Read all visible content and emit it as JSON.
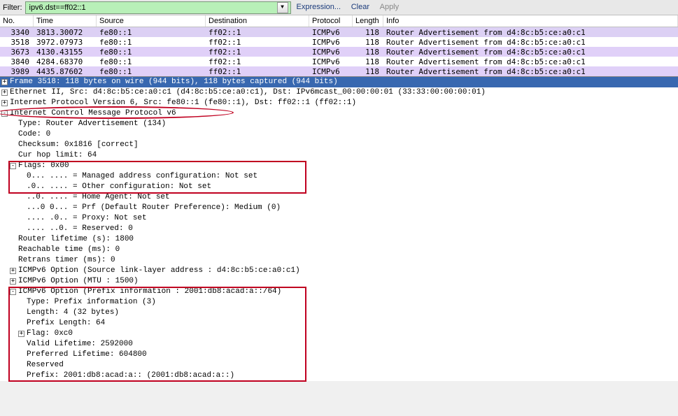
{
  "filter": {
    "label": "Filter:",
    "value": "ipv6.dst==ff02::1",
    "links": {
      "expr": "Expression...",
      "clear": "Clear",
      "apply": "Apply"
    }
  },
  "columns": {
    "no": "No.",
    "time": "Time",
    "src": "Source",
    "dst": "Destination",
    "proto": "Protocol",
    "len": "Length",
    "info": "Info"
  },
  "packets": [
    {
      "no": "3340",
      "time": "3813.30072",
      "src": "fe80::1",
      "dst": "ff02::1",
      "proto": "ICMPv6",
      "len": "118",
      "info": "Router Advertisement from d4:8c:b5:ce:a0:c1",
      "cls": "sel"
    },
    {
      "no": "3518",
      "time": "3972.07973",
      "src": "fe80::1",
      "dst": "ff02::1",
      "proto": "ICMPv6",
      "len": "118",
      "info": "Router Advertisement from d4:8c:b5:ce:a0:c1",
      "cls": ""
    },
    {
      "no": "3673",
      "time": "4130.43155",
      "src": "fe80::1",
      "dst": "ff02::1",
      "proto": "ICMPv6",
      "len": "118",
      "info": "Router Advertisement from d4:8c:b5:ce:a0:c1",
      "cls": "purple"
    },
    {
      "no": "3840",
      "time": "4284.68370",
      "src": "fe80::1",
      "dst": "ff02::1",
      "proto": "ICMPv6",
      "len": "118",
      "info": "Router Advertisement from d4:8c:b5:ce:a0:c1",
      "cls": ""
    },
    {
      "no": "3989",
      "time": "4435.87602",
      "src": "fe80::1",
      "dst": "ff02::1",
      "proto": "ICMPv6",
      "len": "118",
      "info": "Router Advertisement from d4:8c:b5:ce:a0:c1",
      "cls": "purple"
    }
  ],
  "d": {
    "frame": "Frame 3518: 118 bytes on wire (944 bits), 118 bytes captured (944 bits)",
    "eth": "Ethernet II, Src: d4:8c:b5:ce:a0:c1 (d4:8c:b5:ce:a0:c1), Dst: IPv6mcast_00:00:00:01 (33:33:00:00:00:01)",
    "ipv6": "Internet Protocol Version 6, Src: fe80::1 (fe80::1), Dst: ff02::1 (ff02::1)",
    "icmp": "Internet Control Message Protocol v6",
    "type": "Type: Router Advertisement (134)",
    "code": "Code: 0",
    "cksum": "Checksum: 0x1816 [correct]",
    "hop": "Cur hop limit: 64",
    "flags": "Flags: 0x00",
    "f1": "0... .... = Managed address configuration: Not set",
    "f2": ".0.. .... = Other configuration: Not set",
    "f3": "..0. .... = Home Agent: Not set",
    "f4": "...0 0... = Prf (Default Router Preference): Medium (0)",
    "f5": ".... .0.. = Proxy: Not set",
    "f6": ".... ..0. = Reserved: 0",
    "life": "Router lifetime (s): 1800",
    "reach": "Reachable time (ms): 0",
    "retr": "Retrans timer (ms): 0",
    "opt1": "ICMPv6 Option (Source link-layer address : d4:8c:b5:ce:a0:c1)",
    "opt2": "ICMPv6 Option (MTU : 1500)",
    "opt3": "ICMPv6 Option (Prefix information : 2001:db8:acad:a::/64)",
    "pi1": "Type: Prefix information (3)",
    "pi2": "Length: 4 (32 bytes)",
    "pi3": "Prefix Length: 64",
    "pi4": "Flag: 0xc0",
    "pi5": "Valid Lifetime: 2592000",
    "pi6": "Preferred Lifetime: 604800",
    "pi7": "Reserved",
    "pi8": "Prefix: 2001:db8:acad:a:: (2001:db8:acad:a::)"
  }
}
